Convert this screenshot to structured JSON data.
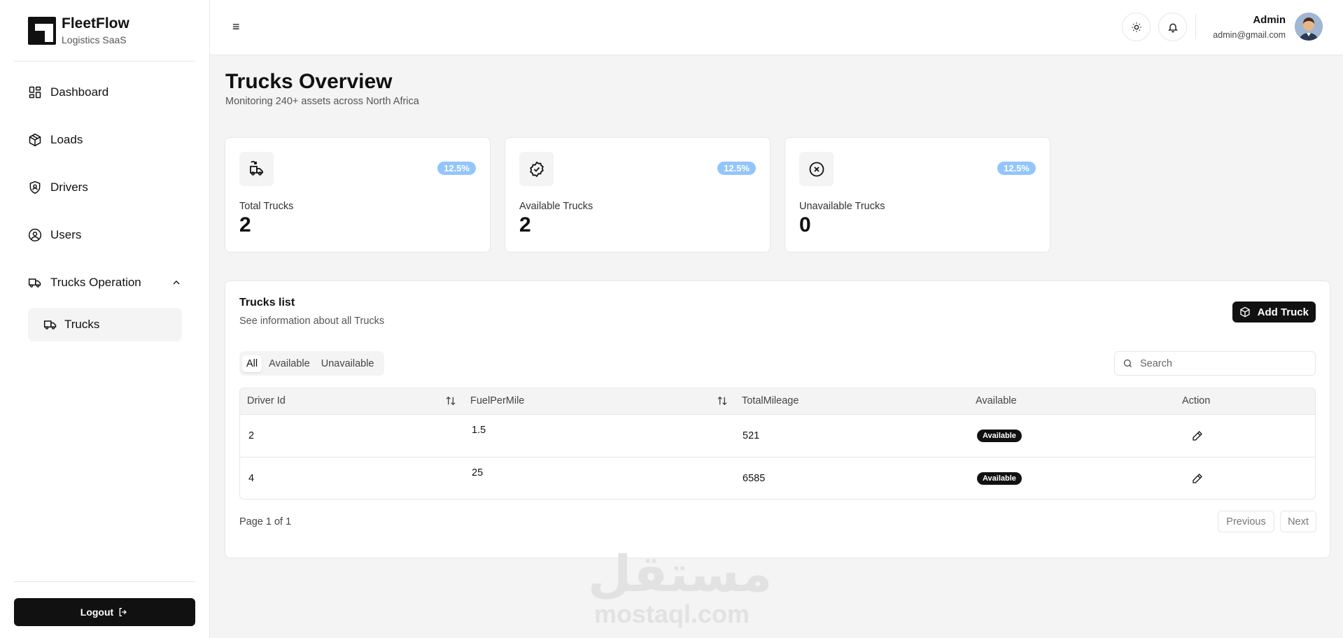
{
  "brand": {
    "name": "FleetFlow",
    "subtitle": "Logistics SaaS"
  },
  "sidebar": {
    "items": [
      {
        "label": "Dashboard",
        "icon": "dashboard-icon"
      },
      {
        "label": "Loads",
        "icon": "box-icon"
      },
      {
        "label": "Drivers",
        "icon": "shield-user-icon"
      },
      {
        "label": "Users",
        "icon": "user-circle-icon"
      },
      {
        "label": "Trucks Operation",
        "icon": "truck-icon",
        "expanded": true
      }
    ],
    "subitems": [
      {
        "label": "Trucks",
        "icon": "truck-icon",
        "active": true
      }
    ],
    "logout_label": "Logout"
  },
  "header": {
    "menu_icon": "≡",
    "theme_icon": "sun-icon",
    "notifications_icon": "bell-icon",
    "user": {
      "name": "Admin",
      "email": "admin@gmail.com"
    }
  },
  "page": {
    "title": "Trucks Overview",
    "subtitle": "Monitoring 240+ assets across North Africa"
  },
  "stats": [
    {
      "label": "Total Trucks",
      "value": "2",
      "badge": "12.5%",
      "icon": "truck-refresh-icon"
    },
    {
      "label": "Available Trucks",
      "value": "2",
      "badge": "12.5%",
      "icon": "check-badge-icon"
    },
    {
      "label": "Unavailable Trucks",
      "value": "0",
      "badge": "12.5%",
      "icon": "x-circle-icon"
    }
  ],
  "trucks_list": {
    "title": "Trucks list",
    "subtitle": "See information about all Trucks",
    "add_label": "Add Truck",
    "tabs": [
      "All",
      "Available",
      "Unavailable"
    ],
    "active_tab": "All",
    "search_placeholder": "Search",
    "columns": [
      "Driver Id",
      "FuelPerMile",
      "TotalMileage",
      "Available",
      "Action"
    ],
    "rows": [
      {
        "driver_id": "2",
        "fuel_per_mile": "1.5",
        "total_mileage": "521",
        "available": "Available"
      },
      {
        "driver_id": "4",
        "fuel_per_mile": "25",
        "total_mileage": "6585",
        "available": "Available"
      }
    ],
    "page_info": "Page 1 of 1",
    "prev_label": "Previous",
    "next_label": "Next"
  },
  "watermark": {
    "arabic": "مستقل",
    "latin": "mostaql.com"
  },
  "colors": {
    "accent_dark": "#111111",
    "badge_blue": "#93c5fd",
    "background": "#f4f4f5"
  }
}
